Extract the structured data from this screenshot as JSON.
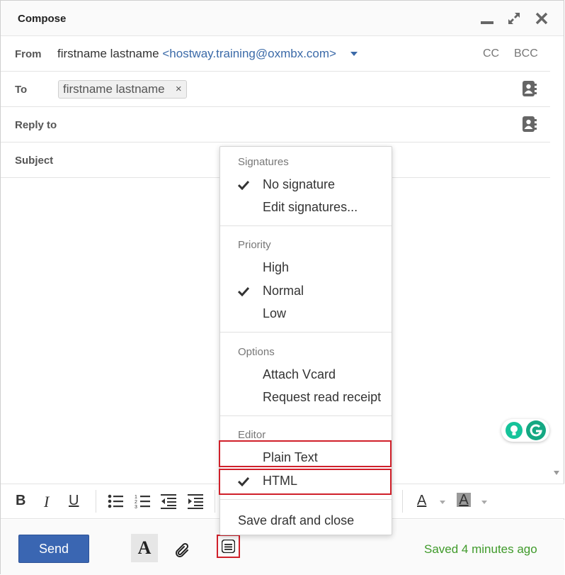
{
  "window": {
    "title": "Compose"
  },
  "from": {
    "label": "From",
    "name": "firstname lastname",
    "email": "<hostway.training@oxmbx.com>",
    "cc_label": "CC",
    "bcc_label": "BCC"
  },
  "to": {
    "label": "To",
    "recipient": "firstname lastname",
    "remove_glyph": "×"
  },
  "reply_to": {
    "label": "Reply to"
  },
  "subject": {
    "label": "Subject"
  },
  "menu": {
    "signatures": {
      "heading": "Signatures",
      "items": [
        "No signature",
        "Edit signatures..."
      ],
      "checked": "No signature"
    },
    "priority": {
      "heading": "Priority",
      "items": [
        "High",
        "Normal",
        "Low"
      ],
      "checked": "Normal"
    },
    "options": {
      "heading": "Options",
      "items": [
        "Attach Vcard",
        "Request read receipt"
      ]
    },
    "editor": {
      "heading": "Editor",
      "items": [
        "Plain Text",
        "HTML"
      ],
      "checked": "HTML"
    },
    "save_close": "Save draft and close"
  },
  "toolbar": {
    "bold": "B",
    "italic": "I",
    "underline": "U",
    "font_color": "A",
    "bg_color": "A"
  },
  "footer": {
    "send_label": "Send",
    "format_label": "A",
    "saved_status": "Saved 4 minutes ago"
  },
  "colors": {
    "accent": "#3a66b2",
    "link": "#3b6aa8",
    "highlight": "#d0202a",
    "saved": "#3f9a2a"
  },
  "icons": [
    "minimize-icon",
    "expand-icon",
    "close-icon",
    "address-book-icon",
    "checkmark-icon",
    "bulleted-list-icon",
    "numbered-list-icon",
    "outdent-icon",
    "indent-icon",
    "paperclip-icon",
    "menu-icon",
    "grammarly-icon"
  ]
}
